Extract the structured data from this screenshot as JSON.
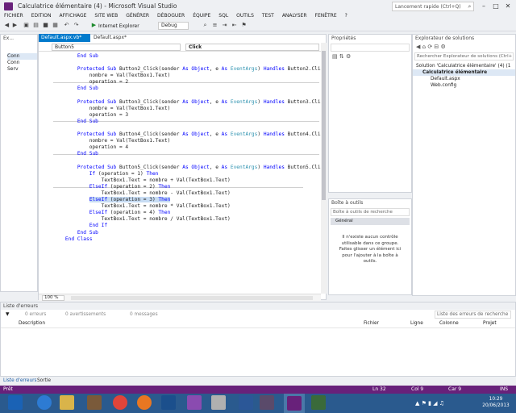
{
  "window": {
    "title": "Calculatrice élémentaire (4) - Microsoft Visual Studio",
    "quick_launch": "Lancement rapide (Ctrl+Q)"
  },
  "menu": [
    "FICHIER",
    "EDITION",
    "AFFICHAGE",
    "SITE WEB",
    "GÉNÉRER",
    "DÉBOGUER",
    "ÉQUIPE",
    "SQL",
    "OUTILS",
    "TEST",
    "ANALYSER",
    "FENÊTRE",
    "?"
  ],
  "toolbar": {
    "run_label": "Internet Explorer",
    "config": "Debug"
  },
  "left_panel": {
    "title": "Ex...",
    "items": [
      "Conn",
      "Conn",
      "Serv"
    ]
  },
  "tabs": [
    {
      "label": "Default.aspx.vb*"
    },
    {
      "label": "Default.aspx*"
    }
  ],
  "nav": {
    "left": "Button5",
    "right": "Click"
  },
  "zoom": "100 %",
  "properties": {
    "title": "Propriétés"
  },
  "toolbox": {
    "title": "Boîte à outils",
    "search": "Boîte à outils de recherche",
    "group": "Général",
    "empty": "Il n'existe aucun contrôle utilisable dans ce groupe. Faites glisser un élément ici pour l'ajouter à la boîte à outils."
  },
  "solution": {
    "title": "Explorateur de solutions",
    "search": "Rechercher Explorateur de solutions (Ctrl+",
    "items": [
      "Solution 'Calculatrice élémentaire' (4) (1",
      "Calculatrice élémentaire",
      "Default.aspx",
      "Web.config"
    ]
  },
  "errors": {
    "title": "Liste d'erreurs",
    "filters": [
      "0 erreurs",
      "0 avertissements",
      "0 messages"
    ],
    "search": "Liste des erreurs de recherche",
    "columns": [
      "Description",
      "Fichier",
      "Ligne",
      "Colonne",
      "Projet"
    ],
    "bottom_tabs": [
      "Liste d'erreurs",
      "Sortie"
    ]
  },
  "status": {
    "left": "Prêt",
    "ln": "Ln 32",
    "col": "Col 9",
    "car": "Car 9",
    "ins": "INS"
  },
  "clock": {
    "time": "10:29",
    "date": "20/06/2013"
  }
}
